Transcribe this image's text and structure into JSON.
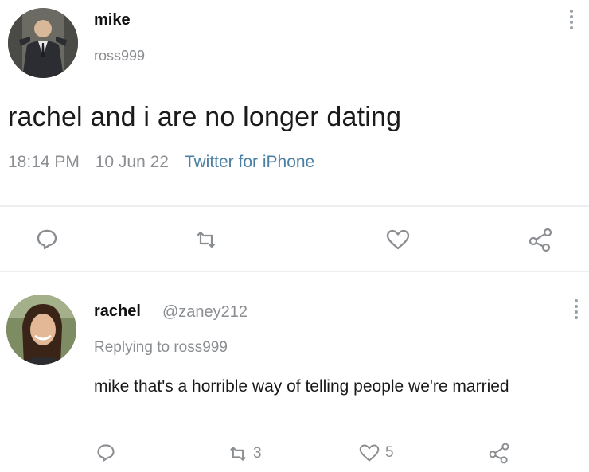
{
  "tweet": {
    "author_name": "mike",
    "author_handle": "ross999",
    "text": "rachel and i are no longer dating",
    "time": "18:14 PM",
    "date": "10 Jun 22",
    "source": "Twitter for iPhone",
    "actions": [
      {
        "icon": "reply-icon"
      },
      {
        "icon": "retweet-icon"
      },
      {
        "icon": "like-icon"
      },
      {
        "icon": "share-icon"
      }
    ]
  },
  "reply": {
    "author_name": "rachel",
    "author_handle": "@zaney212",
    "replying_to": "Replying to ross999",
    "text": "mike that's a horrible way of telling people we're married",
    "retweet_count": "3",
    "like_count": "5"
  },
  "colors": {
    "muted": "#8a8d91",
    "link": "#4b7fa3",
    "divider": "#eceef0"
  }
}
